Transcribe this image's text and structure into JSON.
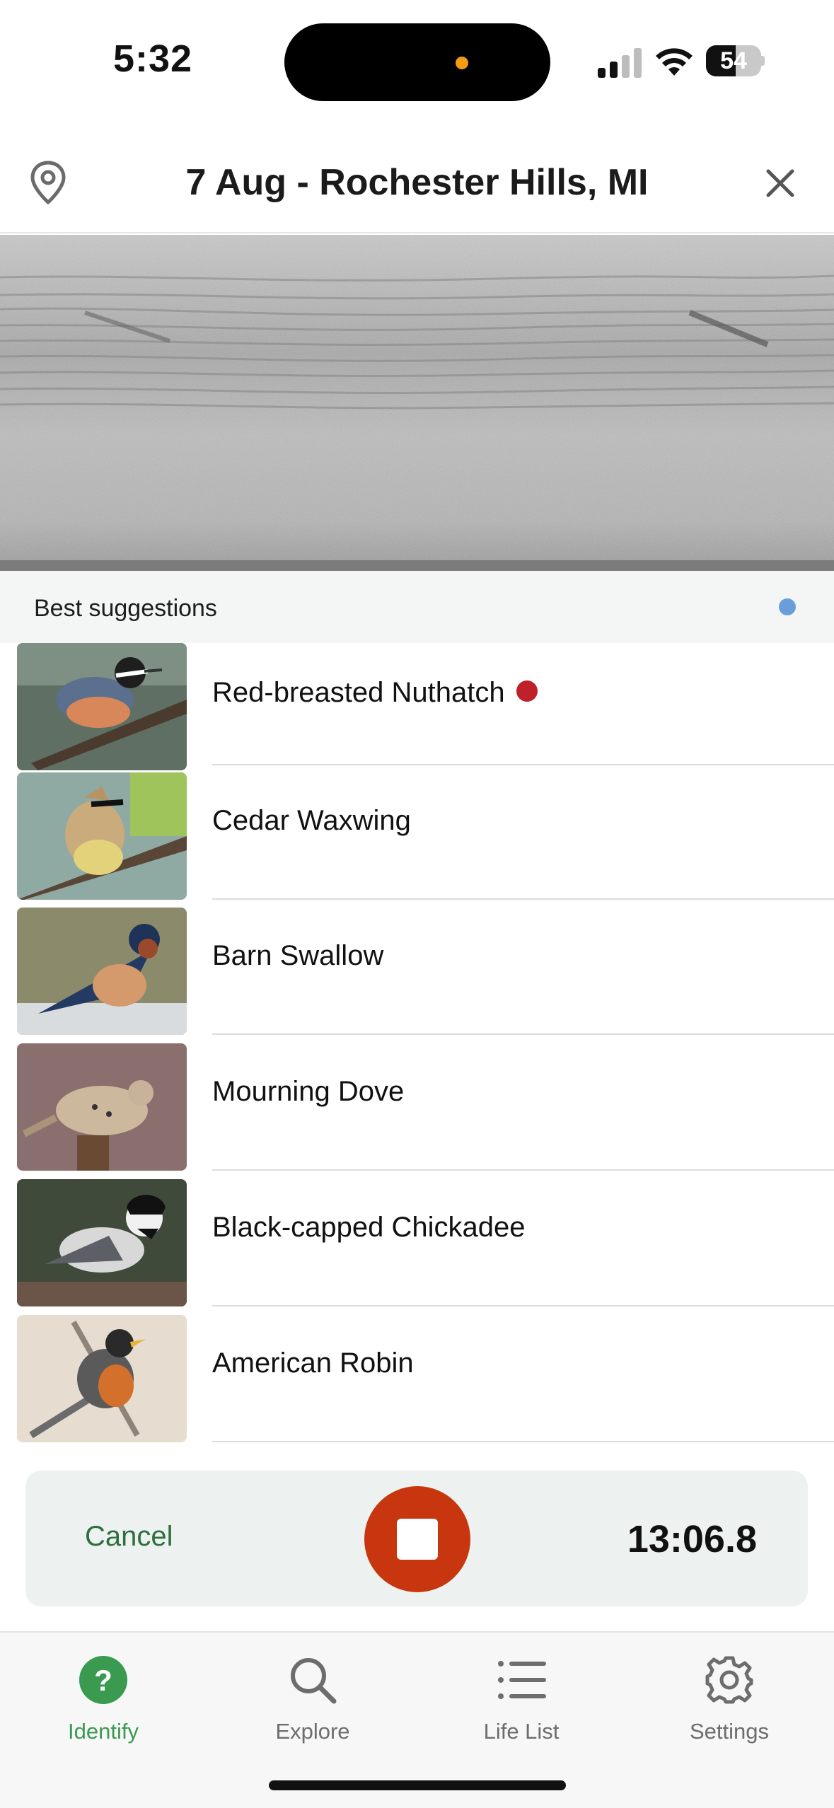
{
  "status_bar": {
    "time": "5:32",
    "battery": "54",
    "battery_level_percent": 54,
    "signal_bars": 2,
    "recording_indicator_color": "#f39c12"
  },
  "header": {
    "title": "7 Aug - Rochester Hills, MI",
    "location_icon": "map-pin-icon",
    "close_icon": "close-icon"
  },
  "spectrogram": {
    "description_icon": "spectrogram"
  },
  "suggestions": {
    "heading": "Best suggestions",
    "indicator_color": "#6a9edb",
    "items": [
      {
        "name": "Red-breasted Nuthatch",
        "highlighted": true,
        "highlight_color": "#c0202a"
      },
      {
        "name": "Cedar Waxwing",
        "highlighted": false
      },
      {
        "name": "Barn Swallow",
        "highlighted": false
      },
      {
        "name": "Mourning Dove",
        "highlighted": false
      },
      {
        "name": "Black-capped Chickadee",
        "highlighted": false
      },
      {
        "name": "American Robin",
        "highlighted": false
      }
    ]
  },
  "recording": {
    "cancel_label": "Cancel",
    "timer": "13:06.8",
    "stop_color": "#c7360e"
  },
  "tabs": [
    {
      "label": "Identify",
      "icon": "question-circle-icon",
      "active": true
    },
    {
      "label": "Explore",
      "icon": "search-icon",
      "active": false
    },
    {
      "label": "Life List",
      "icon": "list-icon",
      "active": false
    },
    {
      "label": "Settings",
      "icon": "gear-icon",
      "active": false
    }
  ],
  "colors": {
    "accent_green": "#3a9a50",
    "cancel_green": "#2f6e3e"
  }
}
